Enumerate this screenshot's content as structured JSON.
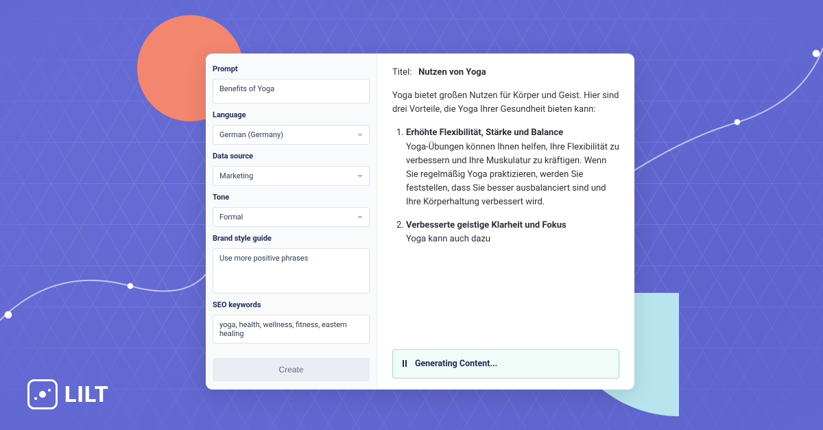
{
  "brand": {
    "name": "LILT"
  },
  "form": {
    "prompt": {
      "label": "Prompt",
      "value": "Benefits of Yoga"
    },
    "language": {
      "label": "Language",
      "value": "German (Germany)"
    },
    "data_source": {
      "label": "Data source",
      "value": "Marketing"
    },
    "tone": {
      "label": "Tone",
      "value": "Formal"
    },
    "brand_style": {
      "label": "Brand style guide",
      "value": "Use more positive phrases"
    },
    "seo": {
      "label": "SEO keywords",
      "value": "yoga, health, wellness, fitness, eastern healing"
    },
    "create_label": "Create"
  },
  "output": {
    "title_label": "Titel:",
    "title_value": "Nutzen von Yoga",
    "intro": "Yoga bietet großen Nutzen für Körper und Geist. Hier sind drei Vorteile, die Yoga Ihrer Gesundheit bieten kann:",
    "items": [
      {
        "title": "Erhöhte Flexibilität, Stärke und Balance",
        "body": "Yoga-Übungen können Ihnen helfen, Ihre Flexibilität zu verbessern und Ihre Muskulatur zu kräftigen. Wenn Sie regelmäßig Yoga praktizieren, werden Sie feststellen, dass Sie besser ausbalanciert sind und Ihre Körperhaltung verbessert wird."
      },
      {
        "title": "Verbesserte geistige Klarheit und Fokus",
        "body": "Yoga kann auch dazu"
      }
    ],
    "status": "Generating Content..."
  }
}
